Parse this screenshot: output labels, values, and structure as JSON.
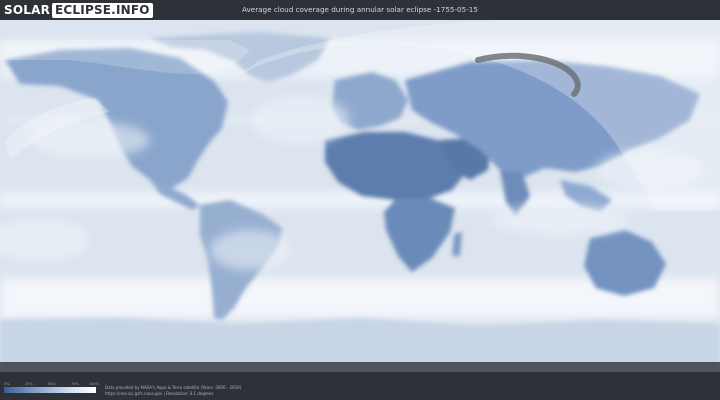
{
  "header": {
    "logo_part1": "SOLAR",
    "logo_part2": "ECLIPSE.INFO",
    "title": "Average cloud coverage during annular solar eclipse -1755-05-15"
  },
  "legend": {
    "ticks": [
      "0%",
      "25%",
      "50%",
      "75%",
      "100%"
    ],
    "colors": [
      "#3c5f94",
      "#6f8fbd",
      "#a5bcd9",
      "#d7e2ef",
      "#ffffff"
    ]
  },
  "footer": {
    "credit_line1": "Data provided by NASA's Aqua & Terra satellite (Years: 2000 - 2019)",
    "credit_line2": "https://neo.sci.gsfc.nasa.gov | Resolution: 0.1 degrees"
  },
  "map": {
    "ocean_color": "#dbe4ef",
    "cloud_color": "#f5f8fc",
    "land_color": "#7f9cc8",
    "dry_land_color": "#5c7dad",
    "shadow_color": "#e9edf2",
    "path_color": "#6e7278"
  }
}
